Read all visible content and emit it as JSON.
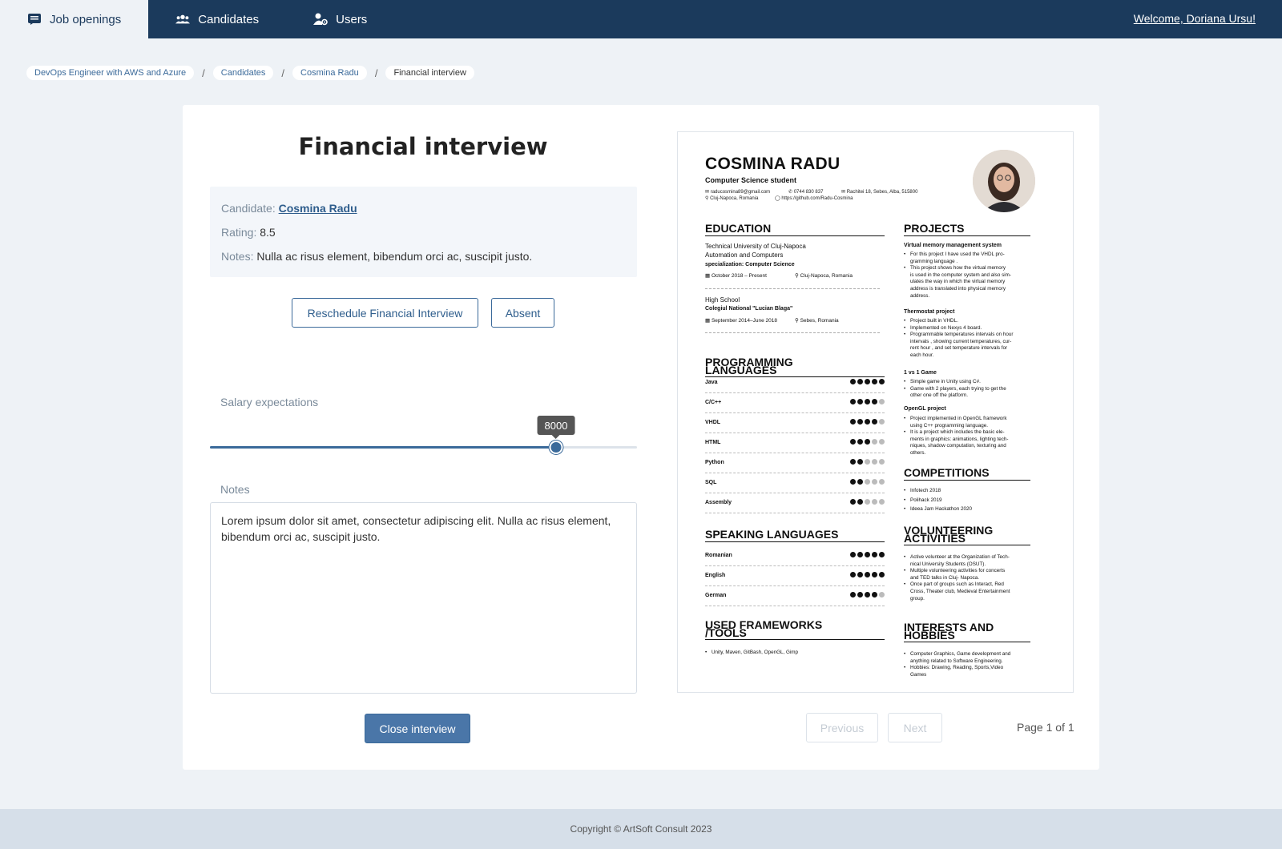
{
  "nav": {
    "items": [
      {
        "label": "Job openings",
        "icon": "list-icon",
        "active": true
      },
      {
        "label": "Candidates",
        "icon": "people-icon",
        "active": false
      },
      {
        "label": "Users",
        "icon": "user-cog-icon",
        "active": false
      }
    ],
    "welcome": "Welcome, Doriana Ursu!"
  },
  "breadcrumb": [
    "DevOps Engineer with AWS and Azure",
    "Candidates",
    "Cosmina Radu",
    "Financial interview"
  ],
  "interview": {
    "title": "Financial interview",
    "candidate_label": "Candidate:",
    "candidate_name": "Cosmina Radu",
    "rating_label": "Rating:",
    "rating_value": "8.5",
    "notes_label": "Notes:",
    "notes_value": "Nulla ac risus element, bibendum orci ac, suscipit justo.",
    "reschedule_label": "Reschedule Financial Interview",
    "absent_label": "Absent",
    "salary_label": "Salary expectations",
    "salary_value": "8000",
    "salary_fraction": 0.81,
    "notes_field_label": "Notes",
    "notes_text": "Lorem ipsum dolor sit amet, consectetur adipiscing elit. Nulla ac risus element, bibendum orci ac, suscipit justo.",
    "close_label": "Close interview"
  },
  "pagination": {
    "previous": "Previous",
    "next": "Next",
    "page_text": "Page 1 of 1"
  },
  "resume": {
    "name": "COSMINA RADU",
    "subtitle": "Computer Science student",
    "email": "raducosmina89@gmail.com",
    "phone": "0744 830 837",
    "address": "Rachitei 18, Sebes, Alba, 515800",
    "city": "Cluj-Napoca, Romania",
    "github": "https://github.com/Radu-Cosmina",
    "education_h": "EDUCATION",
    "edu1_school": "Technical University of Cluj-Napoca",
    "edu1_faculty": "Automation and Computers",
    "edu1_spec": "specialization: Computer Science",
    "edu1_date": "October 2018 – Present",
    "edu1_loc": "Cluj-Napoca, Romania",
    "edu2_school": "High School",
    "edu2_name": "Colegiul National \"Lucian Blaga\"",
    "edu2_date": "September 2014–June 2018",
    "edu2_loc": "Sebes, Romania",
    "prog_h1": "PROGRAMMING",
    "prog_h2": "LANGUAGES",
    "prog": [
      {
        "name": "Java",
        "level": 5
      },
      {
        "name": "C/C++",
        "level": 4
      },
      {
        "name": "VHDL",
        "level": 4
      },
      {
        "name": "HTML",
        "level": 3
      },
      {
        "name": "Python",
        "level": 2
      },
      {
        "name": "SQL",
        "level": 2
      },
      {
        "name": "Assembly",
        "level": 2
      }
    ],
    "speak_h": "SPEAKING LANGUAGES",
    "speak": [
      {
        "name": "Romanian",
        "level": 5
      },
      {
        "name": "English",
        "level": 5
      },
      {
        "name": "German",
        "level": 4
      }
    ],
    "tools_h1": "USED FRAMEWORKS",
    "tools_h2": "/TOOLS",
    "tools": "Unity, Maven, GitBash, OpenGL, Gimp",
    "projects_h": "PROJECTS",
    "p1_title": "Virtual memory management system",
    "p1_b1": "For this project I have used the VHDL pro-",
    "p1_b1b": "gramming language .",
    "p1_b2": "This project shows how the virtual memory",
    "p1_b2b": "is used in the computer system and also sim-",
    "p1_b2c": "ulates the way in which the virtual memory",
    "p1_b2d": "address is translated into physical memory",
    "p1_b2e": "address.",
    "p2_title": "Thermostat project",
    "p2_b1": "Project built in VHDL.",
    "p2_b2": "Implemented on Nexys 4 board.",
    "p2_b3": "Programmable temperatures intervals on hour",
    "p2_b3b": "intervals , showing current temperatures, cur-",
    "p2_b3c": "rent hour , and set temperature intervals for",
    "p2_b3d": "each hour.",
    "p3_title": "1 vs 1 Game",
    "p3_b1": "Simple game in Unity using C#.",
    "p3_b2": "Game with 2 players, each trying to get the",
    "p3_b2b": "other one off the platform.",
    "p4_title": "OpenGL project",
    "p4_b1": "Project implemented in OpenGL framework",
    "p4_b1b": "using C++ programming language.",
    "p4_b2": "It is a project which includes the basic ele-",
    "p4_b2b": "ments in graphics: animations, lighting tech-",
    "p4_b2c": "niques, shadow computation, texturing and",
    "p4_b2d": "others.",
    "comp_h": "COMPETITIONS",
    "comp": [
      "Infotech 2018",
      "Polihack 2019",
      "Ideea Jam Hackathon 2020"
    ],
    "vol_h1": "VOLUNTEERING",
    "vol_h2": "ACTIVITIES",
    "vol_b1": "Active volunteer at the Organization of Tech-",
    "vol_b1b": "nical University Students (OSUT).",
    "vol_b2": "Multiple volunteering activities for concerts",
    "vol_b2b": "and TED talks in Cluj- Napoca.",
    "vol_b3": "Once part of groups such as Interact, Red",
    "vol_b3b": "Cross, Theater club, Medieval Entertainment",
    "vol_b3c": "group.",
    "int_h1": "INTERESTS AND",
    "int_h2": "HOBBIES",
    "int_b1": "Computer Graphics, Game development and",
    "int_b1b": "anything related to Software Engineering.",
    "int_b2": "Hobbies: Drawing, Reading, Sports,Video",
    "int_b2b": "Games"
  },
  "footer": "Copyright © ArtSoft Consult 2023"
}
